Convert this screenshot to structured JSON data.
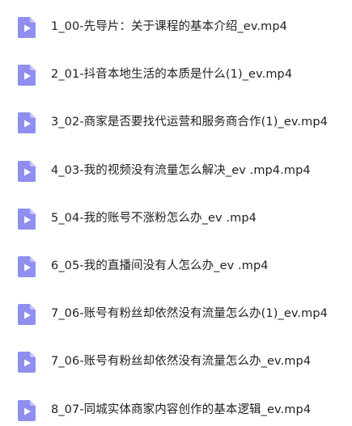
{
  "icon_color": "#8f8ff0",
  "icon_glyph_color": "#ffffff",
  "files": [
    {
      "name": "1_00-先导片：关于课程的基本介绍_ev.mp4",
      "icon": "video-file-icon"
    },
    {
      "name": "2_01-抖音本地生活的本质是什么(1)_ev.mp4",
      "icon": "video-file-icon"
    },
    {
      "name": "3_02-商家是否要找代运营和服务商合作(1)_ev.mp4",
      "icon": "video-file-icon"
    },
    {
      "name": "4_03-我的视频没有流量怎么解决_ev .mp4.mp4",
      "icon": "video-file-icon"
    },
    {
      "name": "5_04-我的账号不涨粉怎么办_ev .mp4",
      "icon": "video-file-icon"
    },
    {
      "name": "6_05-我的直播间没有人怎么办_ev .mp4",
      "icon": "video-file-icon"
    },
    {
      "name": "7_06-账号有粉丝却依然没有流量怎么办(1)_ev.mp4",
      "icon": "video-file-icon"
    },
    {
      "name": "7_06-账号有粉丝却依然没有流量怎么办_ev.mp4",
      "icon": "video-file-icon"
    },
    {
      "name": "8_07-同城实体商家内容创作的基本逻辑_ev.mp4",
      "icon": "video-file-icon"
    }
  ]
}
